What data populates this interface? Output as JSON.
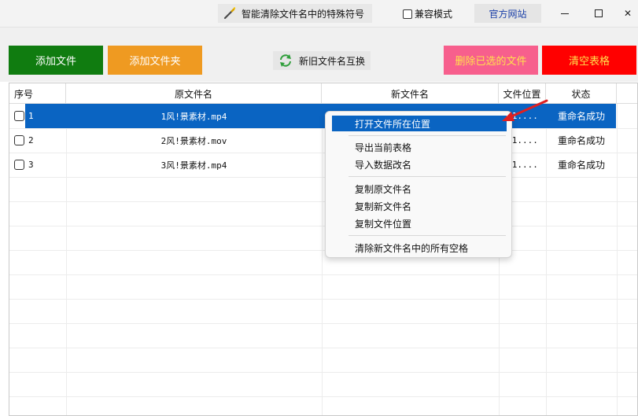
{
  "window": {
    "title": "智能清除文件名中的特殊符号",
    "compat_mode_label": "兼容模式",
    "official_site_label": "官方网站",
    "minimize_glyph": "–",
    "close_glyph": "✕"
  },
  "toolbar": {
    "add_file": "添加文件",
    "add_folder": "添加文件夹",
    "swap_names": "新旧文件名互换",
    "delete_selected": "删除已选的文件",
    "clear_table": "清空表格"
  },
  "table": {
    "columns": [
      "序号",
      "原文件名",
      "新文件名",
      "文件位置",
      "状态"
    ],
    "rows": [
      {
        "index": "1",
        "original": "1风!景素材.mp4",
        "new": "",
        "location": "\\1....",
        "status": "重命名成功"
      },
      {
        "index": "2",
        "original": "2风!景素材.mov",
        "new": "",
        "location": "\\1....",
        "status": "重命名成功"
      },
      {
        "index": "3",
        "original": "3风!景素材.mp4",
        "new": "",
        "location": "\\1....",
        "status": "重命名成功"
      }
    ]
  },
  "context_menu": {
    "items": [
      "打开文件所在位置",
      "导出当前表格",
      "导入数据改名",
      "复制原文件名",
      "复制新文件名",
      "复制文件位置",
      "清除新文件名中的所有空格"
    ]
  },
  "colors": {
    "add_file": "#107c10",
    "add_folder": "#ef9a21",
    "delete_selected": "#f75f8d",
    "clear_table": "#ff0000",
    "selection": "#0a64c2",
    "annotation_arrow": "#e02020"
  },
  "icons": {
    "title": "magic-wand-icon",
    "swap": "refresh-arrows-icon"
  }
}
